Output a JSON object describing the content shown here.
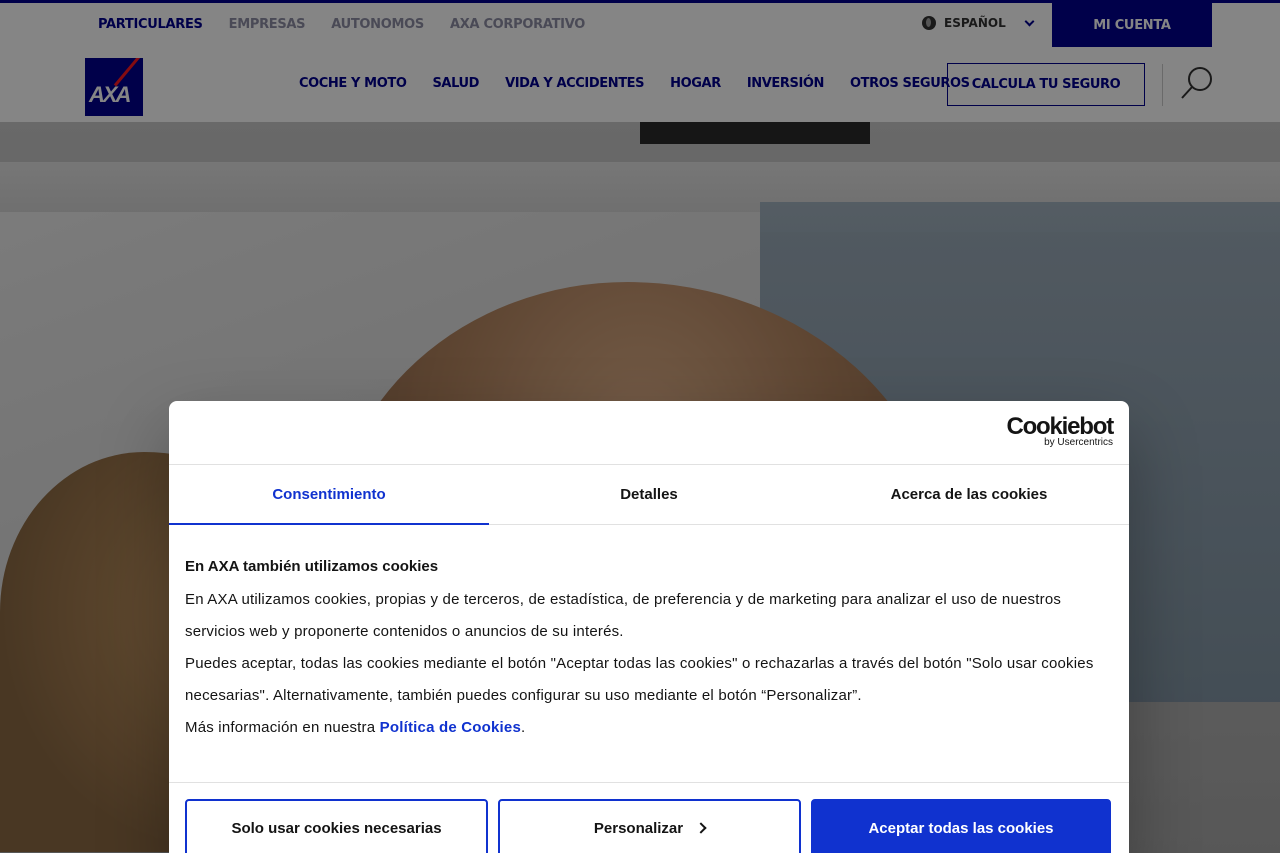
{
  "header": {
    "top_nav": [
      "PARTICULARES",
      "EMPRESAS",
      "AUTONOMOS",
      "AXA CORPORATIVO"
    ],
    "language": "ESPAÑOL",
    "account_label": "MI CUENTA",
    "logo_text": "AXA",
    "main_nav": [
      "COCHE Y MOTO",
      "SALUD",
      "VIDA Y ACCIDENTES",
      "HOGAR",
      "INVERSIÓN",
      "OTROS SEGUROS"
    ],
    "cta_label": "CALCULA TU SEGURO",
    "brand_color": "#00008f",
    "accent_red": "#ff1721"
  },
  "cookie_dialog": {
    "brand": "Cookiebot",
    "brand_sub": "by Usercentrics",
    "tabs": [
      "Consentimiento",
      "Detalles",
      "Acerca de las cookies"
    ],
    "active_tab": "Consentimiento",
    "heading": "En AXA también utilizamos cookies",
    "paragraph1": "En AXA utilizamos cookies, propias y de terceros, de estadística, de preferencia y de marketing para analizar el uso de nuestros servicios web y proponerte contenidos o anuncios de su interés.",
    "paragraph2": "Puedes aceptar, todas las cookies mediante el botón \"Aceptar todas las cookies\" o rechazarlas a través del botón \"Solo usar cookies necesarias\". Alternativamente, también puedes configurar su uso mediante el botón “Personalizar”.",
    "more_info_prefix": "Más información en nuestra ",
    "more_info_link": "Política de Cookies",
    "more_info_suffix": ".",
    "btn_necessary": "Solo usar cookies necesarias",
    "btn_customize": "Personalizar",
    "btn_accept_all": "Aceptar todas las cookies",
    "accent_color": "#1032cf"
  }
}
